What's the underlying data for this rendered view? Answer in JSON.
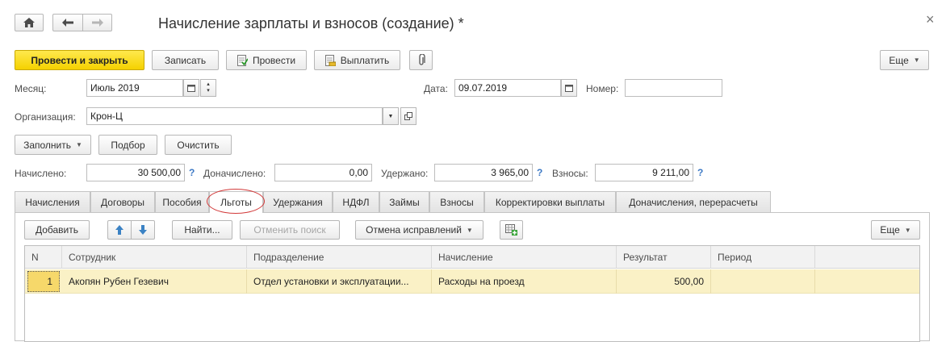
{
  "window": {
    "title": "Начисление зарплаты и взносов (создание) *",
    "close_symbol": "×",
    "icons": [
      "home-icon",
      "back-arrow-icon",
      "forward-arrow-icon",
      "close-icon"
    ]
  },
  "toolbar": {
    "post_close_label": "Провести и закрыть",
    "write_label": "Записать",
    "post_label": "Провести",
    "pay_label": "Выплатить",
    "more_label": "Еще"
  },
  "fields": {
    "month_label": "Месяц:",
    "month_value": "Июль 2019",
    "date_label": "Дата:",
    "date_value": "09.07.2019",
    "number_label": "Номер:",
    "number_value": "",
    "org_label": "Организация:",
    "org_value": "Крон-Ц"
  },
  "fill_buttons": {
    "fill_label": "Заполнить",
    "select_label": "Подбор",
    "clear_label": "Очистить"
  },
  "totals": {
    "accrued_label": "Начислено:",
    "accrued_value": "30 500,00",
    "additional_label": "Доначислено:",
    "additional_value": "0,00",
    "withheld_label": "Удержано:",
    "withheld_value": "3 965,00",
    "contrib_label": "Взносы:",
    "contrib_value": "9 211,00",
    "help_symbol": "?"
  },
  "tabs": [
    {
      "label": "Начисления"
    },
    {
      "label": "Договоры"
    },
    {
      "label": "Пособия"
    },
    {
      "label": "Льготы",
      "active": true
    },
    {
      "label": "Удержания"
    },
    {
      "label": "НДФЛ"
    },
    {
      "label": "Займы"
    },
    {
      "label": "Взносы"
    },
    {
      "label": "Корректировки выплаты"
    },
    {
      "label": "Доначисления, перерасчеты"
    }
  ],
  "table_toolbar": {
    "add_label": "Добавить",
    "find_label": "Найти...",
    "cancel_search_label": "Отменить поиск",
    "cancel_fix_label": "Отмена исправлений",
    "more_label": "Еще"
  },
  "table": {
    "columns": [
      "N",
      "Сотрудник",
      "Подразделение",
      "Начисление",
      "Результат",
      "Период"
    ],
    "rows": [
      [
        "1",
        "Акопян Рубен Гезевич",
        "Отдел установки и эксплуатации...",
        "Расходы на проезд",
        "500,00",
        ""
      ]
    ]
  },
  "colors": {
    "primary_button": "#f5d100",
    "selected_row": "#faf1c6",
    "highlight_ellipse": "#d23a3a",
    "help_link": "#3d79c5"
  }
}
